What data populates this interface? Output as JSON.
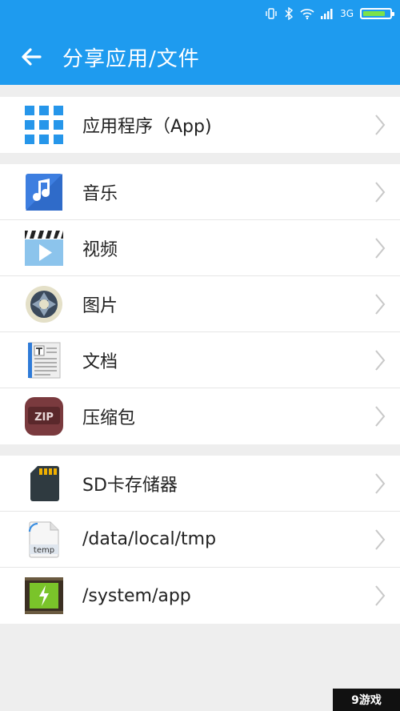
{
  "status_bar": {
    "network": "3G",
    "battery_level": 0.85,
    "icons": [
      "vibrate-icon",
      "bluetooth-icon",
      "wifi-icon",
      "signal-icon",
      "battery-icon"
    ]
  },
  "header": {
    "title": "分享应用/文件",
    "back_icon": "arrow-left-icon"
  },
  "groups": [
    {
      "items": [
        {
          "label": "应用程序（App)",
          "icon": "app-grid-icon"
        }
      ]
    },
    {
      "items": [
        {
          "label": "音乐",
          "icon": "music-icon"
        },
        {
          "label": "视频",
          "icon": "video-icon"
        },
        {
          "label": "图片",
          "icon": "camera-aperture-icon"
        },
        {
          "label": "文档",
          "icon": "document-icon"
        },
        {
          "label": "压缩包",
          "icon": "zip-icon"
        }
      ]
    },
    {
      "items": [
        {
          "label": "SD卡存储器",
          "icon": "sd-card-icon"
        },
        {
          "label": "/data/local/tmp",
          "icon": "temp-file-icon"
        },
        {
          "label": "/system/app",
          "icon": "system-app-icon"
        }
      ]
    }
  ],
  "watermark": "9游戏",
  "colors": {
    "header": "#1e9bef",
    "background": "#eeeeee",
    "row": "#ffffff",
    "chevron": "#c8c8c8"
  }
}
